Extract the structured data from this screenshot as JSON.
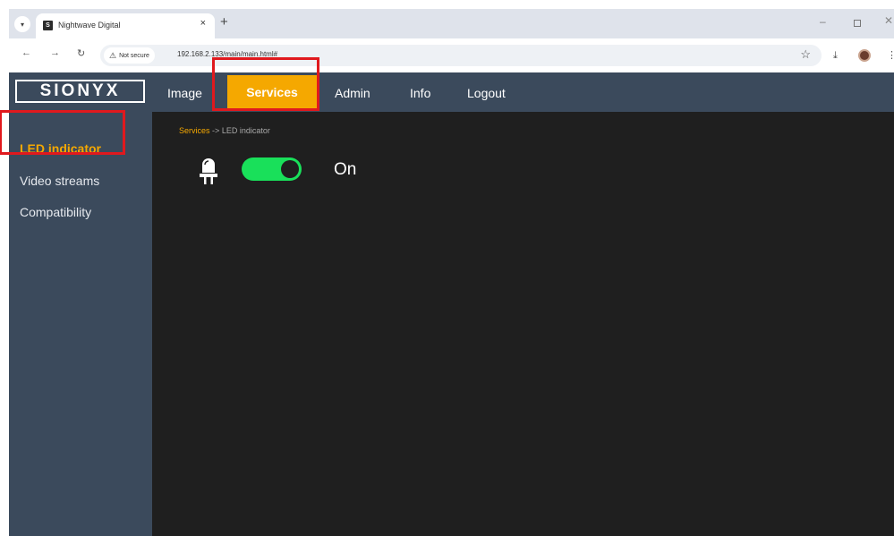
{
  "browser": {
    "tab_title": "Nightwave Digital",
    "favicon_letter": "S",
    "new_tab": "+",
    "close_tab": "×",
    "security_label": "Not secure",
    "url": "192.168.2.133/main/main.html#"
  },
  "icons": {
    "back": "←",
    "forward": "→",
    "reload": "↻",
    "warn": "⚠",
    "star": "☆",
    "download": "⤓",
    "menu": "⋮",
    "tab_menu": "▾",
    "minimize": "–",
    "close": "✕"
  },
  "app": {
    "logo": "SIONYX",
    "nav": [
      {
        "label": "Image"
      },
      {
        "label": "Services"
      },
      {
        "label": "Admin"
      },
      {
        "label": "Info"
      },
      {
        "label": "Logout"
      }
    ],
    "active_nav": "Services"
  },
  "sidebar": {
    "items": [
      {
        "label": "LED indicator"
      },
      {
        "label": "Video streams"
      },
      {
        "label": "Compatibility"
      }
    ],
    "active_item": "LED indicator"
  },
  "content": {
    "breadcrumb": {
      "section": "Services",
      "separator": "->",
      "page": "LED indicator"
    },
    "led_toggle": {
      "enabled": true,
      "state_label": "On"
    }
  },
  "colors": {
    "accent": "#f5a800",
    "header_bg": "#3b4a5c",
    "content_bg": "#1f1f1f",
    "toggle_on": "#19e05a",
    "highlight_box": "#e0191e"
  }
}
